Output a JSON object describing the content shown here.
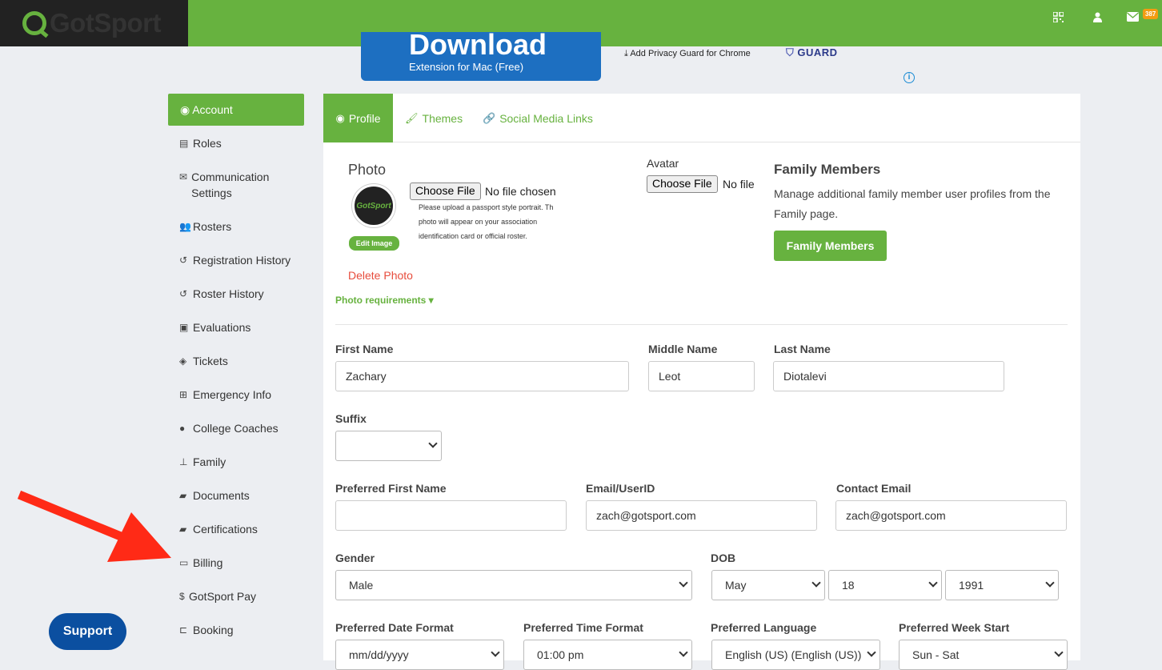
{
  "brand": {
    "logo_text": "GotSport"
  },
  "topbar": {
    "mail_count": "387",
    "icons": [
      "qr-icon",
      "user-icon",
      "mail-icon"
    ]
  },
  "ad": {
    "headline": "Download",
    "subline": "Extension for Mac (Free)",
    "privacy_link": "Add Privacy Guard for Chrome",
    "guard_text": "GUARD"
  },
  "sidebar": {
    "items": [
      {
        "label": "Account",
        "icon": "user-circle-icon"
      },
      {
        "label": "Roles",
        "icon": "id-card-icon"
      },
      {
        "label": "Communication Settings",
        "icon": "envelope-icon"
      },
      {
        "label": "Rosters",
        "icon": "users-icon"
      },
      {
        "label": "Registration History",
        "icon": "history-icon"
      },
      {
        "label": "Roster History",
        "icon": "history-icon"
      },
      {
        "label": "Evaluations",
        "icon": "calendar-check-icon"
      },
      {
        "label": "Tickets",
        "icon": "tag-icon"
      },
      {
        "label": "Emergency Info",
        "icon": "plus-square-icon"
      },
      {
        "label": "College Coaches",
        "icon": "user-icon"
      },
      {
        "label": "Family",
        "icon": "sitemap-icon"
      },
      {
        "label": "Documents",
        "icon": "folder-icon"
      },
      {
        "label": "Certifications",
        "icon": "folder-icon"
      },
      {
        "label": "Billing",
        "icon": "credit-card-icon"
      },
      {
        "label": "GotSport Pay",
        "icon": "dollar-icon"
      },
      {
        "label": "Booking",
        "icon": "bed-icon"
      }
    ]
  },
  "tabs": [
    {
      "label": "Profile",
      "icon": "user-circle-icon"
    },
    {
      "label": "Themes",
      "icon": "brush-icon"
    },
    {
      "label": "Social Media Links",
      "icon": "link-icon"
    }
  ],
  "photo": {
    "title": "Photo",
    "choose_file": "Choose File",
    "no_file": "No file chosen",
    "note_lines": [
      "Please upload a passport style portrait. Th",
      "photo will appear on your association",
      "identification card or official roster."
    ],
    "avatar_logo": "GotSport",
    "edit_image": "Edit Image",
    "delete_photo": "Delete Photo",
    "requirements": "Photo requirements ▾"
  },
  "avatar": {
    "title": "Avatar",
    "choose_file": "Choose File",
    "no_file": "No file"
  },
  "family": {
    "title": "Family Members",
    "description": "Manage additional family member user profiles from the Family page.",
    "button": "Family Members"
  },
  "form": {
    "first_name": {
      "label": "First Name",
      "value": "Zachary"
    },
    "middle_name": {
      "label": "Middle Name",
      "value": "Leot"
    },
    "last_name": {
      "label": "Last Name",
      "value": "Diotalevi"
    },
    "suffix": {
      "label": "Suffix",
      "value": ""
    },
    "preferred_first_name": {
      "label": "Preferred First Name",
      "value": ""
    },
    "email_userid": {
      "label": "Email/UserID",
      "value": "zach@gotsport.com"
    },
    "contact_email": {
      "label": "Contact Email",
      "value": "zach@gotsport.com"
    },
    "gender": {
      "label": "Gender",
      "value": "Male"
    },
    "dob": {
      "label": "DOB",
      "month": "May",
      "day": "18",
      "year": "1991"
    },
    "date_format": {
      "label": "Preferred Date Format",
      "value": "mm/dd/yyyy"
    },
    "time_format": {
      "label": "Preferred Time Format",
      "value": "01:00 pm"
    },
    "language": {
      "label": "Preferred Language",
      "value": "English (US) (English (US))"
    },
    "week_start": {
      "label": "Preferred Week Start",
      "value": "Sun - Sat"
    }
  },
  "support": {
    "label": "Support"
  },
  "colors": {
    "brand_green": "#67b23f",
    "support_blue": "#0b4fa0",
    "arrow_red": "#ff2a16"
  }
}
